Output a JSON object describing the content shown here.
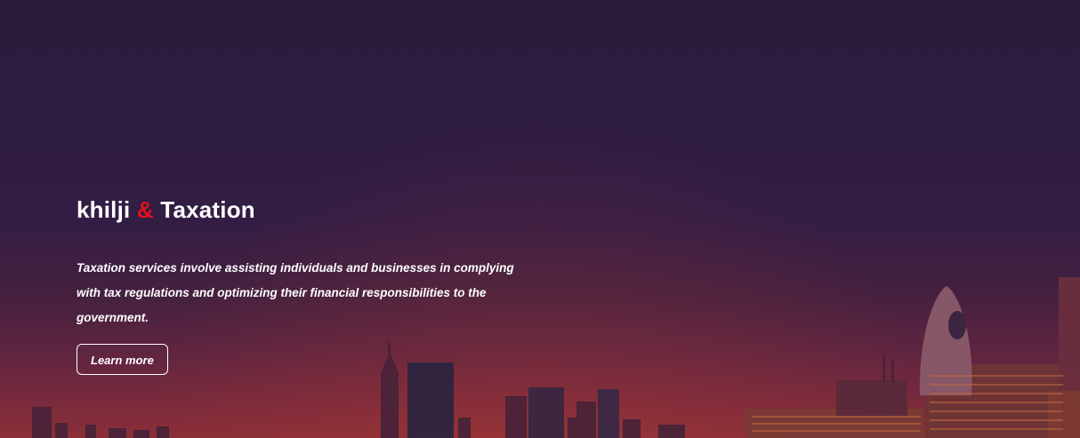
{
  "hero": {
    "title_part1": "khilji",
    "title_amp": "&",
    "title_part2": "Taxation",
    "description": "Taxation services involve assisting individuals and businesses in complying with tax regulations and optimizing their financial responsibilities to the government.",
    "button_label": "Learn more"
  },
  "colors": {
    "accent": "#e3111b",
    "text": "#ffffff",
    "sky_top": "#2a1c3a",
    "sky_bottom": "#8a2f38"
  }
}
